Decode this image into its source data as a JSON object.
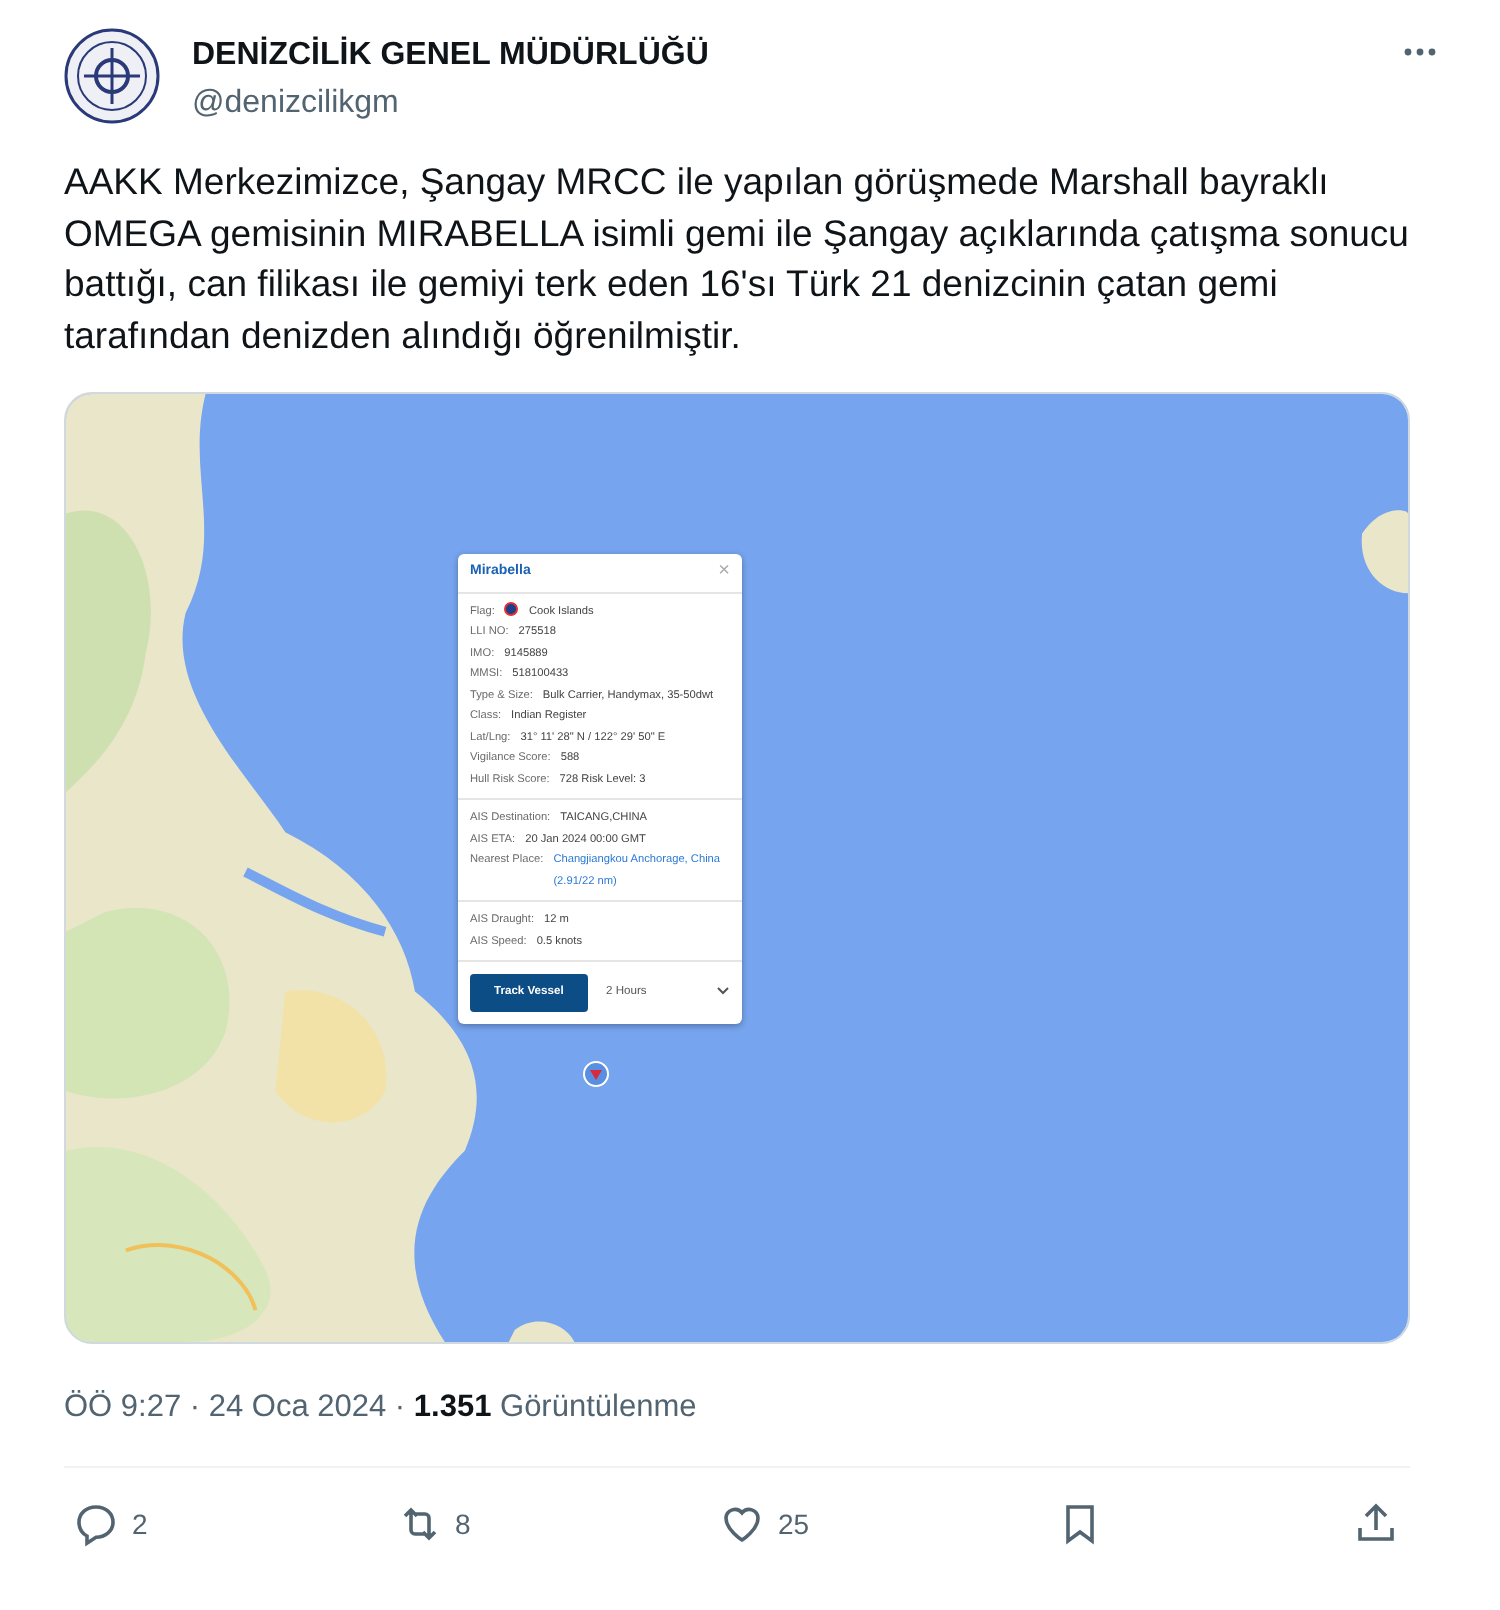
{
  "account": {
    "name": "DENİZCİLİK GENEL MÜDÜRLÜĞÜ",
    "handle": "@denizcilikgm"
  },
  "text": "AAKK Merkezimizce, Şangay MRCC ile yapılan görüşmede Marshall bayraklı OMEGA gemisinin  MIRABELLA isimli gemi ile Şangay açıklarında çatışma sonucu battığı, can filikası ile gemiyi terk eden 16'sı Türk 21 denizcinin çatan gemi tarafından denizden alındığı öğrenilmiştir.",
  "media": {
    "kind": "picture",
    "popup": {
      "title": "Mirabella",
      "close": "×",
      "sections": [
        [
          {
            "label": "Flag:",
            "value": "Cook Islands",
            "flag": true
          },
          {
            "label": "LLI NO:",
            "value": "275518"
          },
          {
            "label": "IMO:",
            "value": "9145889"
          },
          {
            "label": "MMSI:",
            "value": "518100433"
          },
          {
            "label": "Type & Size:",
            "value": "Bulk Carrier, Handymax, 35-50dwt"
          },
          {
            "label": "Class:",
            "value": "Indian Register"
          },
          {
            "label": "Lat/Lng:",
            "value": "31° 11' 28\" N / 122° 29' 50\" E"
          },
          {
            "label": "Vigilance Score:",
            "value": "588"
          },
          {
            "label": "Hull Risk Score:",
            "value": "728   Risk Level:  3"
          }
        ],
        [
          {
            "label": "AIS Destination:",
            "value": "TAICANG,CHINA"
          },
          {
            "label": "AIS ETA:",
            "value": "20 Jan 2024 00:00 GMT"
          },
          {
            "label": "Nearest Place:",
            "value": "Changjiangkou Anchorage, China (2.91/22 nm)",
            "link": true
          }
        ],
        [
          {
            "label": "AIS Draught:",
            "value": "12 m"
          },
          {
            "label": "AIS Speed:",
            "value": "0.5 knots"
          }
        ]
      ],
      "button": "Track Vessel",
      "select": "2 Hours"
    }
  },
  "meta": "ÖÖ 9:27 · 24 Oca 2024 · **1.351** Görüntülenme",
  "actions": [
    {
      "kind": "reply",
      "count": "2"
    },
    {
      "kind": "retweet",
      "count": "8"
    },
    {
      "kind": "like",
      "count": "25"
    },
    {
      "kind": "bookmark"
    },
    {
      "kind": "share"
    }
  ]
}
